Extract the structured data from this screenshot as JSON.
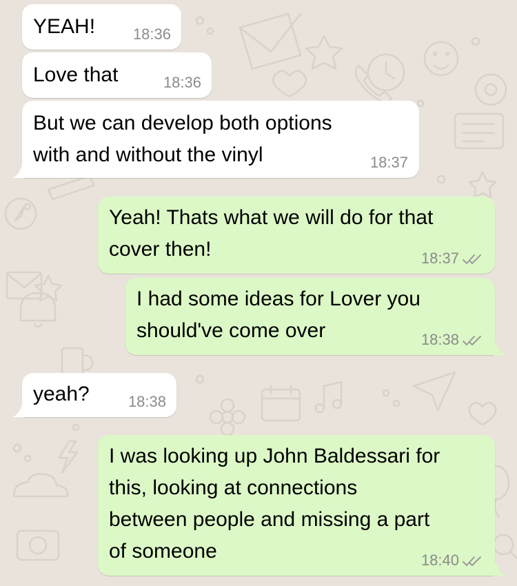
{
  "messages": [
    {
      "direction": "incoming",
      "text": "YEAH!",
      "time": "18:36"
    },
    {
      "direction": "incoming",
      "text": "Love that",
      "time": "18:36"
    },
    {
      "direction": "incoming",
      "text": "But we can develop both options\nwith and without the vinyl",
      "time": "18:37"
    },
    {
      "direction": "outgoing",
      "text": "Yeah! Thats what we will do for that\ncover then!",
      "time": "18:37",
      "status": "read"
    },
    {
      "direction": "outgoing",
      "text": "I had some ideas for Lover you\nshould've come over",
      "time": "18:38",
      "status": "read"
    },
    {
      "direction": "incoming",
      "text": "yeah?",
      "time": "18:38"
    },
    {
      "direction": "outgoing",
      "text": "I was looking up John Baldessari for\nthis, looking at connections\nbetween people and missing a part\nof someone",
      "time": "18:40",
      "status": "read"
    }
  ],
  "colors": {
    "background": "#e9e3dc",
    "incoming_bubble": "#ffffff",
    "outgoing_bubble": "#dcf8c6",
    "timestamp": "#8b8b8b"
  }
}
